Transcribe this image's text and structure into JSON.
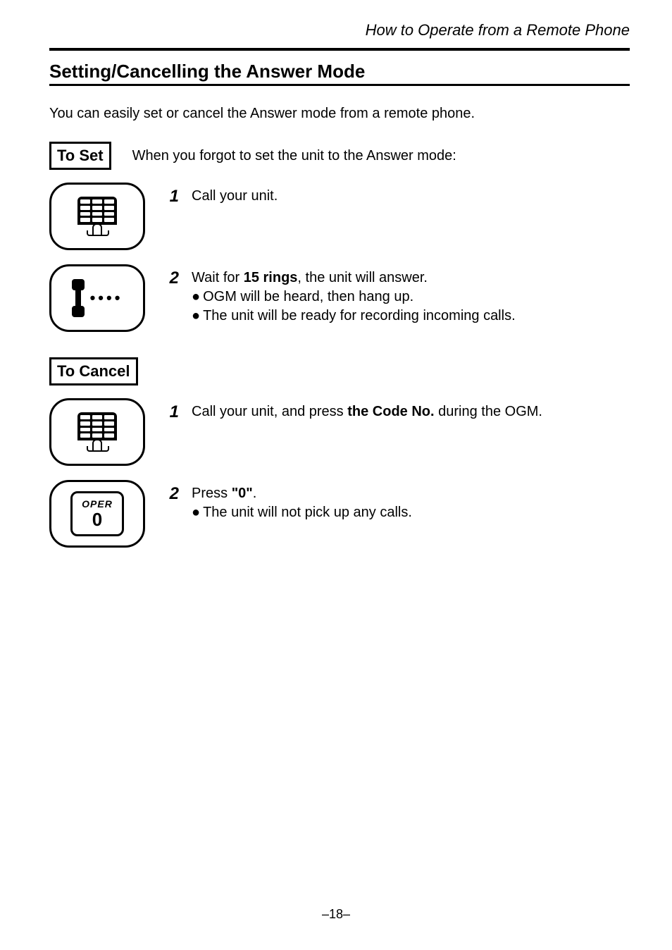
{
  "running_head": "How to Operate from a Remote Phone",
  "section_title": "Setting/Cancelling the Answer Mode",
  "intro": "You can easily set or cancel the Answer mode from a remote phone.",
  "to_set": {
    "label": "To Set",
    "description": "When you forgot to set the unit to the Answer mode:",
    "steps": [
      {
        "num": "1",
        "text": "Call your unit."
      },
      {
        "num": "2",
        "text_pre": "Wait for ",
        "bold1": "15 rings",
        "text_post": ", the unit will answer.",
        "bullets": [
          "OGM will be heard, then hang up.",
          "The unit will be ready for recording incoming calls."
        ]
      }
    ]
  },
  "to_cancel": {
    "label": "To Cancel",
    "steps": [
      {
        "num": "1",
        "text_pre": "Call your unit, and press ",
        "bold1": "the Code No.",
        "text_post": " during the OGM."
      },
      {
        "num": "2",
        "text_pre": "Press ",
        "bold1": "\"0\"",
        "text_post": ".",
        "bullets": [
          "The unit will not pick up any calls."
        ]
      }
    ]
  },
  "icons": {
    "keypad": "keypad-icon",
    "handset": "handset-ringing-icon",
    "oper_label": "OPER",
    "oper_digit": "0"
  },
  "page_number": "–18–"
}
